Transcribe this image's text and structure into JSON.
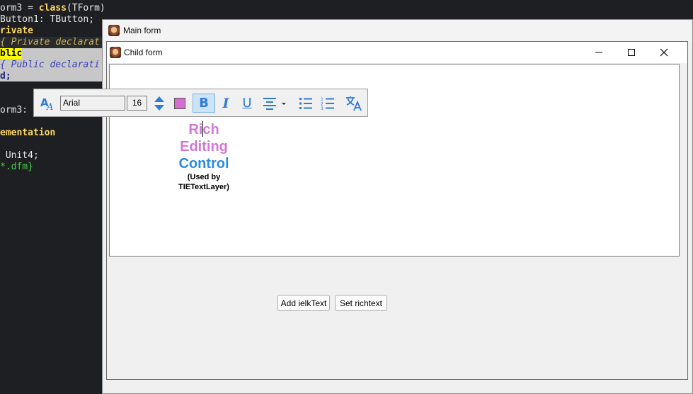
{
  "code_lines": [
    {
      "pre": "",
      "kw": "",
      "text": "orm3 = ",
      "kw2": "class",
      "post": "(TForm)"
    },
    {
      "text": "Button1: TButton;"
    },
    {
      "kw": "rivate"
    },
    {
      "comment": "{ Private declarat"
    },
    {
      "highlight": "blic"
    },
    {
      "comment2": "{ Public declarati"
    },
    {
      "kw": "d;"
    },
    {
      "text": ""
    },
    {
      "text": ""
    },
    {
      "text": "orm3: T"
    },
    {
      "text": ""
    },
    {
      "kw": "ementation"
    },
    {
      "text": ""
    },
    {
      "text": " Unit4;"
    },
    {
      "green": "*.dfm}"
    }
  ],
  "main_form": {
    "title": "Main form"
  },
  "child_form": {
    "title": "Child form",
    "minimize": "—",
    "maximize": "☐",
    "close": "✕"
  },
  "rich_text": {
    "line1": "Rich",
    "line2": "Editing",
    "line3": "Control",
    "line4": "(Used by",
    "line5": "TIETextLayer)"
  },
  "toolbar": {
    "font_name": "Arial",
    "font_size": "16",
    "color_swatch": "#d46fd0",
    "bold_label": "B",
    "italic_label": "I",
    "underline_label": "U"
  },
  "buttons": {
    "add_ielk_text": "Add ielkText",
    "set_richtext": "Set richtext"
  }
}
